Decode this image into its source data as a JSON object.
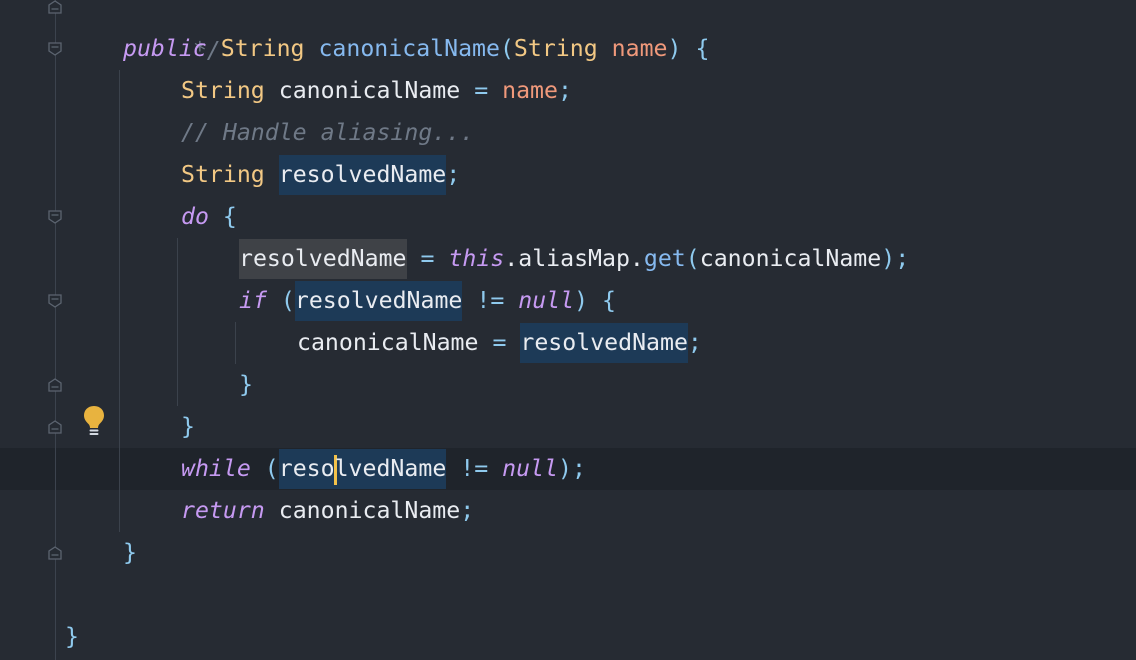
{
  "editor": {
    "language": "java",
    "caret_line": 11,
    "icons": {
      "fold_markers": "fold-marker-icon",
      "intention": "lightbulb-icon"
    },
    "colors": {
      "background": "#262b33",
      "current_line": "#1f242b",
      "keyword": "#c69af2",
      "type": "#f2c884",
      "function": "#86b9ef",
      "parameter": "#f0997b",
      "comment": "#6f7987",
      "identifier": "#e9ecf1",
      "usage_highlight": "#1d3a57",
      "write_highlight": "#3f4247",
      "caret": "#f3c24a",
      "bulb": "#e8b33f"
    }
  },
  "code": {
    "l0": {
      "t0": "*/"
    },
    "l1": {
      "t0": "public",
      "t1": "String",
      "t2": "canonicalName",
      "t3": "(",
      "t4": "String",
      "t5": "name",
      "t6": ")",
      "t7": "{"
    },
    "l2": {
      "t0": "String",
      "t1": "canonicalName",
      "t2": "=",
      "t3": "name",
      "t4": ";"
    },
    "l3": {
      "t0": "// Handle aliasing..."
    },
    "l4": {
      "t0": "String",
      "t1": "resolvedName",
      "t2": ";"
    },
    "l5": {
      "t0": "do",
      "t1": "{"
    },
    "l6": {
      "t0": "resolvedName",
      "t1": "=",
      "t2": "this",
      "t3": ".aliasMap.",
      "t4": "get",
      "t5": "(",
      "t6": "canonicalName",
      "t7": ");"
    },
    "l7": {
      "t0": "if",
      "t1": "(",
      "t2": "resolvedName",
      "t3": "!=",
      "t4": "null",
      "t5": ")",
      "t6": "{"
    },
    "l8": {
      "t0": "canonicalName",
      "t1": "=",
      "t2": "resolvedName",
      "t3": ";"
    },
    "l9": {
      "t0": "}"
    },
    "l10": {
      "t0": "}"
    },
    "l11": {
      "t0": "while",
      "t1": "(",
      "t2a": "reso",
      "t2b": "lvedName",
      "t3": "!=",
      "t4": "null",
      "t5": ");"
    },
    "l12": {
      "t0": "return",
      "t1": "canonicalName",
      "t2": ";"
    },
    "l13": {
      "t0": "}"
    },
    "l14": {
      "t0": "}"
    }
  }
}
